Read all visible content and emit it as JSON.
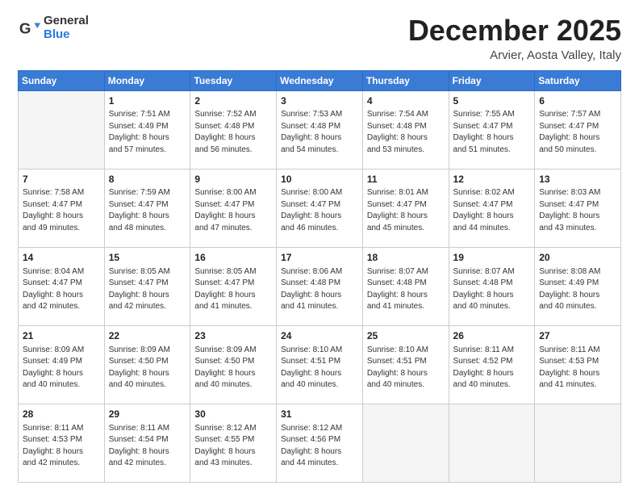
{
  "header": {
    "logo_general": "General",
    "logo_blue": "Blue",
    "title": "December 2025",
    "location": "Arvier, Aosta Valley, Italy"
  },
  "days_of_week": [
    "Sunday",
    "Monday",
    "Tuesday",
    "Wednesday",
    "Thursday",
    "Friday",
    "Saturday"
  ],
  "weeks": [
    [
      {
        "day": "",
        "info": ""
      },
      {
        "day": "1",
        "info": "Sunrise: 7:51 AM\nSunset: 4:49 PM\nDaylight: 8 hours\nand 57 minutes."
      },
      {
        "day": "2",
        "info": "Sunrise: 7:52 AM\nSunset: 4:48 PM\nDaylight: 8 hours\nand 56 minutes."
      },
      {
        "day": "3",
        "info": "Sunrise: 7:53 AM\nSunset: 4:48 PM\nDaylight: 8 hours\nand 54 minutes."
      },
      {
        "day": "4",
        "info": "Sunrise: 7:54 AM\nSunset: 4:48 PM\nDaylight: 8 hours\nand 53 minutes."
      },
      {
        "day": "5",
        "info": "Sunrise: 7:55 AM\nSunset: 4:47 PM\nDaylight: 8 hours\nand 51 minutes."
      },
      {
        "day": "6",
        "info": "Sunrise: 7:57 AM\nSunset: 4:47 PM\nDaylight: 8 hours\nand 50 minutes."
      }
    ],
    [
      {
        "day": "7",
        "info": "Sunrise: 7:58 AM\nSunset: 4:47 PM\nDaylight: 8 hours\nand 49 minutes."
      },
      {
        "day": "8",
        "info": "Sunrise: 7:59 AM\nSunset: 4:47 PM\nDaylight: 8 hours\nand 48 minutes."
      },
      {
        "day": "9",
        "info": "Sunrise: 8:00 AM\nSunset: 4:47 PM\nDaylight: 8 hours\nand 47 minutes."
      },
      {
        "day": "10",
        "info": "Sunrise: 8:00 AM\nSunset: 4:47 PM\nDaylight: 8 hours\nand 46 minutes."
      },
      {
        "day": "11",
        "info": "Sunrise: 8:01 AM\nSunset: 4:47 PM\nDaylight: 8 hours\nand 45 minutes."
      },
      {
        "day": "12",
        "info": "Sunrise: 8:02 AM\nSunset: 4:47 PM\nDaylight: 8 hours\nand 44 minutes."
      },
      {
        "day": "13",
        "info": "Sunrise: 8:03 AM\nSunset: 4:47 PM\nDaylight: 8 hours\nand 43 minutes."
      }
    ],
    [
      {
        "day": "14",
        "info": "Sunrise: 8:04 AM\nSunset: 4:47 PM\nDaylight: 8 hours\nand 42 minutes."
      },
      {
        "day": "15",
        "info": "Sunrise: 8:05 AM\nSunset: 4:47 PM\nDaylight: 8 hours\nand 42 minutes."
      },
      {
        "day": "16",
        "info": "Sunrise: 8:05 AM\nSunset: 4:47 PM\nDaylight: 8 hours\nand 41 minutes."
      },
      {
        "day": "17",
        "info": "Sunrise: 8:06 AM\nSunset: 4:48 PM\nDaylight: 8 hours\nand 41 minutes."
      },
      {
        "day": "18",
        "info": "Sunrise: 8:07 AM\nSunset: 4:48 PM\nDaylight: 8 hours\nand 41 minutes."
      },
      {
        "day": "19",
        "info": "Sunrise: 8:07 AM\nSunset: 4:48 PM\nDaylight: 8 hours\nand 40 minutes."
      },
      {
        "day": "20",
        "info": "Sunrise: 8:08 AM\nSunset: 4:49 PM\nDaylight: 8 hours\nand 40 minutes."
      }
    ],
    [
      {
        "day": "21",
        "info": "Sunrise: 8:09 AM\nSunset: 4:49 PM\nDaylight: 8 hours\nand 40 minutes."
      },
      {
        "day": "22",
        "info": "Sunrise: 8:09 AM\nSunset: 4:50 PM\nDaylight: 8 hours\nand 40 minutes."
      },
      {
        "day": "23",
        "info": "Sunrise: 8:09 AM\nSunset: 4:50 PM\nDaylight: 8 hours\nand 40 minutes."
      },
      {
        "day": "24",
        "info": "Sunrise: 8:10 AM\nSunset: 4:51 PM\nDaylight: 8 hours\nand 40 minutes."
      },
      {
        "day": "25",
        "info": "Sunrise: 8:10 AM\nSunset: 4:51 PM\nDaylight: 8 hours\nand 40 minutes."
      },
      {
        "day": "26",
        "info": "Sunrise: 8:11 AM\nSunset: 4:52 PM\nDaylight: 8 hours\nand 40 minutes."
      },
      {
        "day": "27",
        "info": "Sunrise: 8:11 AM\nSunset: 4:53 PM\nDaylight: 8 hours\nand 41 minutes."
      }
    ],
    [
      {
        "day": "28",
        "info": "Sunrise: 8:11 AM\nSunset: 4:53 PM\nDaylight: 8 hours\nand 42 minutes."
      },
      {
        "day": "29",
        "info": "Sunrise: 8:11 AM\nSunset: 4:54 PM\nDaylight: 8 hours\nand 42 minutes."
      },
      {
        "day": "30",
        "info": "Sunrise: 8:12 AM\nSunset: 4:55 PM\nDaylight: 8 hours\nand 43 minutes."
      },
      {
        "day": "31",
        "info": "Sunrise: 8:12 AM\nSunset: 4:56 PM\nDaylight: 8 hours\nand 44 minutes."
      },
      {
        "day": "",
        "info": ""
      },
      {
        "day": "",
        "info": ""
      },
      {
        "day": "",
        "info": ""
      }
    ]
  ]
}
